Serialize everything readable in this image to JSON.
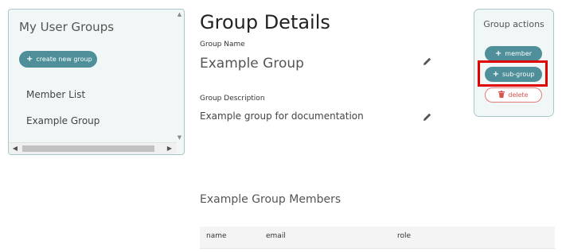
{
  "sidebar": {
    "title": "My User Groups",
    "create_button": "create new group",
    "items": [
      "Member List",
      "Example Group"
    ]
  },
  "details": {
    "title": "Group Details",
    "name_label": "Group Name",
    "name_value": "Example Group",
    "description_label": "Group Description",
    "description_value": "Example group for documentation"
  },
  "actions": {
    "title": "Group actions",
    "member_button": "member",
    "subgroup_button": "sub-group",
    "delete_button": "delete"
  },
  "members": {
    "title": "Example Group Members",
    "columns": [
      "name",
      "email",
      "role"
    ]
  },
  "colors": {
    "accent": "#4e8f99",
    "danger": "#d9534f",
    "highlight": "#e00000"
  }
}
